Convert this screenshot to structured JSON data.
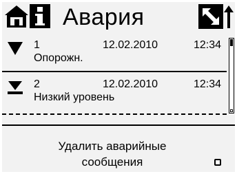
{
  "header": {
    "title": "Авария",
    "icons": {
      "home": "home-icon",
      "info": "info-icon",
      "nav": "expand-arrow-icon"
    }
  },
  "alarms": [
    {
      "icon": "triangle-down-icon",
      "number": "1",
      "date": "12.02.2010",
      "time": "12:34",
      "text": "Опорожн."
    },
    {
      "icon": "level-low-icon",
      "number": "2",
      "date": "12.02.2010",
      "time": "12:34",
      "text": "Низкий уровень"
    }
  ],
  "action": {
    "label": "Удалить аварийные сообщения"
  },
  "colors": {
    "background": "#f2f2f2",
    "foreground": "#000000"
  }
}
